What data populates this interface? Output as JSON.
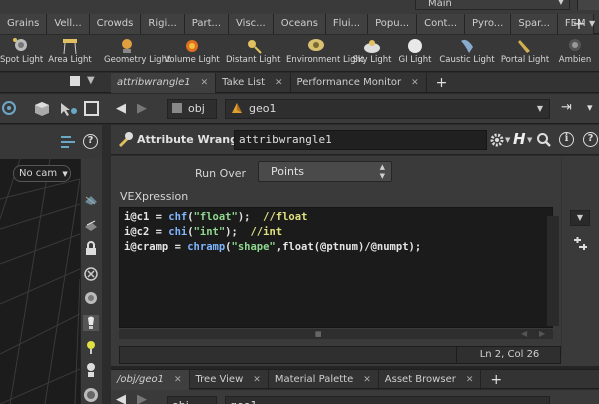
{
  "shelf": {
    "desktop_label": "Main",
    "tabs": [
      {
        "label": "Grains",
        "close": true
      },
      {
        "label": "Vell...",
        "close": false
      },
      {
        "label": "Crowds",
        "close": false
      },
      {
        "label": "Rigi...",
        "close": false
      },
      {
        "label": "Part...",
        "close": false
      },
      {
        "label": "Visc...",
        "close": false
      },
      {
        "label": "Oceans",
        "close": false
      },
      {
        "label": "Flui...",
        "close": false
      },
      {
        "label": "Popu...",
        "close": false
      },
      {
        "label": "Cont...",
        "close": false
      },
      {
        "label": "Pyro...",
        "close": false
      },
      {
        "label": "Spar...",
        "close": false
      },
      {
        "label": "FEM",
        "close": false
      }
    ],
    "tools": [
      {
        "label": "Spot Light",
        "icon": "spot-light-icon"
      },
      {
        "label": "Area Light",
        "icon": "area-light-icon"
      },
      {
        "label": "Geometry Light",
        "icon": "geometry-light-icon"
      },
      {
        "label": "Volume Light",
        "icon": "volume-light-icon"
      },
      {
        "label": "Distant Light",
        "icon": "distant-light-icon"
      },
      {
        "label": "Environment Light",
        "icon": "environment-light-icon"
      },
      {
        "label": "Sky Light",
        "icon": "sky-light-icon"
      },
      {
        "label": "GI Light",
        "icon": "gi-light-icon"
      },
      {
        "label": "Caustic Light",
        "icon": "caustic-light-icon"
      },
      {
        "label": "Portal Light",
        "icon": "portal-light-icon"
      },
      {
        "label": "Ambien",
        "icon": "ambient-light-icon"
      }
    ]
  },
  "viewer": {
    "camera_menu": "No cam"
  },
  "param_pane": {
    "tabs": [
      {
        "label": "attribwrangle1",
        "active": true
      },
      {
        "label": "Take List",
        "active": false
      },
      {
        "label": "Performance Monitor",
        "active": false
      }
    ],
    "path": {
      "context": "obj",
      "node": "geo1"
    },
    "node_type": "Attribute Wrangle",
    "node_name": "attribwrangle1",
    "run_over_label": "Run Over",
    "run_over_value": "Points",
    "vex_label": "VEXpression",
    "code": [
      {
        "var": "i@c1",
        "eq": " = ",
        "fn": "chf",
        "open": "(",
        "str": "\"float\"",
        "close": ");",
        "pad": "  ",
        "comment": "//float"
      },
      {
        "var": "i@c2",
        "eq": " = ",
        "fn": "chi",
        "open": "(",
        "str": "\"int\"",
        "close": ");",
        "pad": "  ",
        "comment": "//int"
      },
      {
        "var": "i@cramp",
        "eq": " = ",
        "fn": "chramp",
        "open": "(",
        "str": "\"shape\"",
        "close": ",float(@ptnum)/@numpt);",
        "pad": "",
        "comment": ""
      }
    ],
    "cursor_position": "Ln 2, Col 26"
  },
  "network_pane": {
    "tabs": [
      {
        "label": "/obj/geo1",
        "active": true
      },
      {
        "label": "Tree View",
        "active": false
      },
      {
        "label": "Material Palette",
        "active": false
      },
      {
        "label": "Asset Browser",
        "active": false
      }
    ],
    "path": {
      "context": "obj",
      "node": "geo1"
    }
  },
  "colors": {
    "code_function": "#7fb6ff",
    "code_string": "#8fd88f",
    "code_comment": "#e0e080"
  }
}
